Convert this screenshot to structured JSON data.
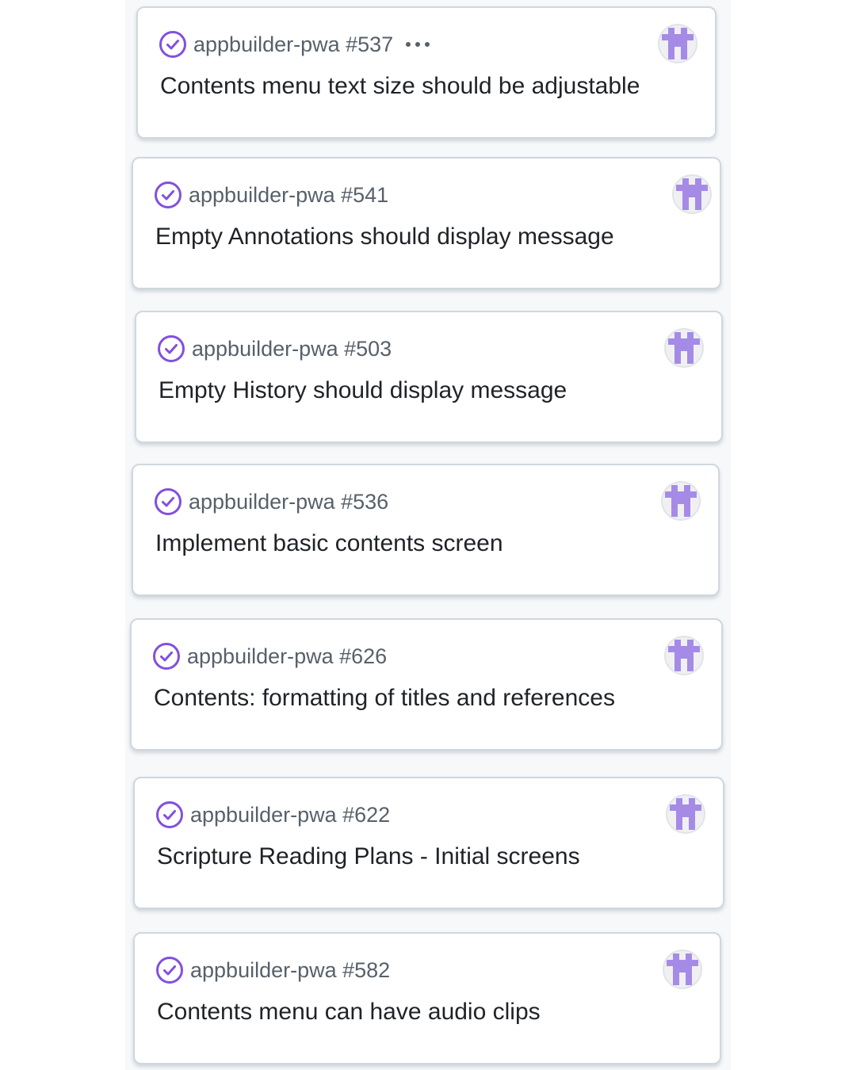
{
  "colors": {
    "status_icon": "#8250df",
    "avatar_fill": "#a58be6",
    "ref_text": "#57606a",
    "title_text": "#1f2328",
    "card_border": "#d0d7de"
  },
  "cards": [
    {
      "ref": "appbuilder-pwa #537",
      "title": "Contents menu text size should be adjustable",
      "status_icon": "check-circle-icon",
      "has_menu": true
    },
    {
      "ref": "appbuilder-pwa #541",
      "title": "Empty Annotations should display message",
      "status_icon": "check-circle-icon"
    },
    {
      "ref": "appbuilder-pwa #503",
      "title": "Empty History should display message",
      "status_icon": "check-circle-icon"
    },
    {
      "ref": "appbuilder-pwa #536",
      "title": "Implement basic contents screen",
      "status_icon": "check-circle-icon"
    },
    {
      "ref": "appbuilder-pwa #626",
      "title": "Contents: formatting of titles and references",
      "status_icon": "check-circle-icon"
    },
    {
      "ref": "appbuilder-pwa #622",
      "title": "Scripture Reading Plans - Initial screens",
      "status_icon": "check-circle-icon"
    },
    {
      "ref": "appbuilder-pwa #582",
      "title": "Contents menu can have audio clips",
      "status_icon": "check-circle-icon"
    }
  ]
}
